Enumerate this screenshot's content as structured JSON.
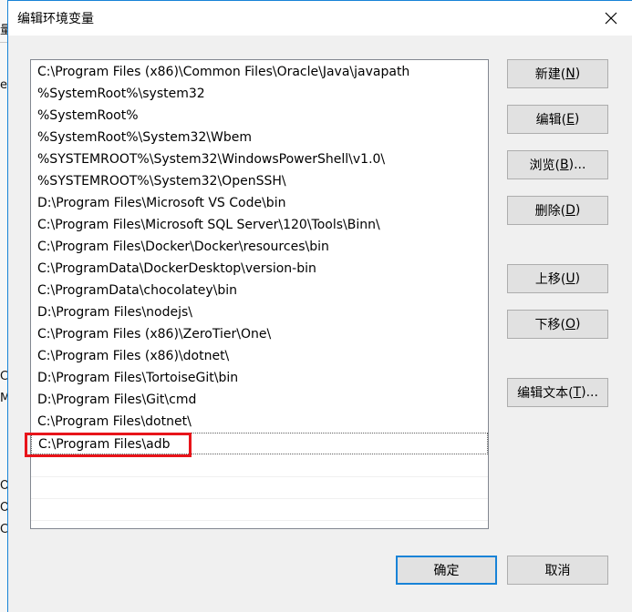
{
  "background_window": {
    "fragments": [
      "量",
      "ey",
      "C",
      "M",
      "O",
      "O",
      "C"
    ]
  },
  "dialog": {
    "title": "编辑环境变量",
    "close_label": "✕"
  },
  "entries": [
    "C:\\Program Files (x86)\\Common Files\\Oracle\\Java\\javapath",
    "%SystemRoot%\\system32",
    "%SystemRoot%",
    "%SystemRoot%\\System32\\Wbem",
    "%SYSTEMROOT%\\System32\\WindowsPowerShell\\v1.0\\",
    "%SYSTEMROOT%\\System32\\OpenSSH\\",
    "D:\\Program Files\\Microsoft VS Code\\bin",
    "C:\\Program Files\\Microsoft SQL Server\\120\\Tools\\Binn\\",
    "C:\\Program Files\\Docker\\Docker\\resources\\bin",
    "C:\\ProgramData\\DockerDesktop\\version-bin",
    "C:\\ProgramData\\chocolatey\\bin",
    "D:\\Program Files\\nodejs\\",
    "C:\\Program Files (x86)\\ZeroTier\\One\\",
    "C:\\Program Files (x86)\\dotnet\\",
    "D:\\Program Files\\TortoiseGit\\bin",
    "D:\\Program Files\\Git\\cmd",
    "C:\\Program Files\\dotnet\\",
    "C:\\Program Files\\adb"
  ],
  "selected_entry_index": 17,
  "buttons": {
    "new": {
      "text": "新建(",
      "key": "N",
      "end": ")"
    },
    "edit": {
      "text": "编辑(",
      "key": "E",
      "end": ")"
    },
    "browse": {
      "text": "浏览(",
      "key": "B",
      "end": ")..."
    },
    "delete": {
      "text": "删除(",
      "key": "D",
      "end": ")"
    },
    "move_up": {
      "text": "上移(",
      "key": "U",
      "end": ")"
    },
    "move_down": {
      "text": "下移(",
      "key": "O",
      "end": ")"
    },
    "edit_text": {
      "text": "编辑文本(",
      "key": "T",
      "end": ")..."
    },
    "ok": "确定",
    "cancel": "取消"
  },
  "colors": {
    "accent": "#1883d7",
    "highlight_box": "#e8141a"
  }
}
